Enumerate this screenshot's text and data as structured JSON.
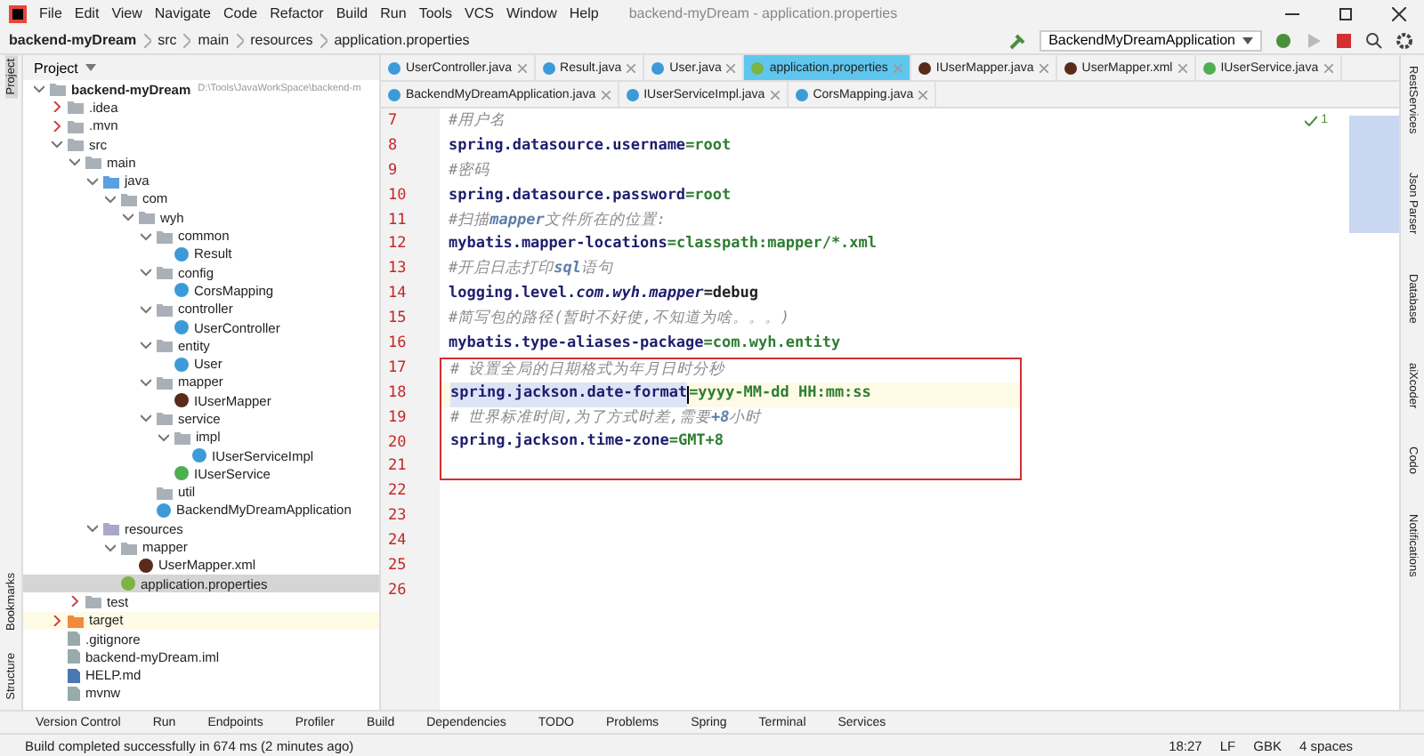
{
  "window": {
    "title": "backend-myDream - application.properties"
  },
  "menu": [
    "File",
    "Edit",
    "View",
    "Navigate",
    "Code",
    "Refactor",
    "Build",
    "Run",
    "Tools",
    "VCS",
    "Window",
    "Help"
  ],
  "breadcrumb": [
    "backend-myDream",
    "src",
    "main",
    "resources",
    "application.properties"
  ],
  "run_config": "BackendMyDreamApplication",
  "left_strip": [
    {
      "label": "Project",
      "selected": true
    },
    {
      "label": "Bookmarks",
      "selected": false
    },
    {
      "label": "Structure",
      "selected": false
    }
  ],
  "project": {
    "title": "Project",
    "tree": [
      {
        "label": "backend-myDream",
        "path": "D:\\Tools\\JavaWorkSpace\\backend-m",
        "kind": "module",
        "expanded": true,
        "selected": false,
        "children": [
          {
            "label": ".idea",
            "kind": "folder",
            "expanded": false,
            "selected": false
          },
          {
            "label": ".mvn",
            "kind": "folder",
            "expanded": false,
            "selected": false
          },
          {
            "label": "src",
            "kind": "folder",
            "expanded": true,
            "selected": false,
            "children": [
              {
                "label": "main",
                "kind": "folder",
                "expanded": true,
                "selected": false,
                "children": [
                  {
                    "label": "java",
                    "kind": "source",
                    "expanded": true,
                    "selected": false,
                    "children": [
                      {
                        "label": "com",
                        "kind": "package",
                        "expanded": true,
                        "selected": false,
                        "children": [
                          {
                            "label": "wyh",
                            "kind": "package",
                            "expanded": true,
                            "selected": false,
                            "children": [
                              {
                                "label": "common",
                                "kind": "package",
                                "expanded": true,
                                "selected": false,
                                "children": [
                                  {
                                    "label": "Result",
                                    "kind": "class",
                                    "selected": false
                                  }
                                ]
                              },
                              {
                                "label": "config",
                                "kind": "package",
                                "expanded": true,
                                "selected": false,
                                "children": [
                                  {
                                    "label": "CorsMapping",
                                    "kind": "class",
                                    "selected": false
                                  }
                                ]
                              },
                              {
                                "label": "controller",
                                "kind": "package",
                                "expanded": true,
                                "selected": false,
                                "children": [
                                  {
                                    "label": "UserController",
                                    "kind": "class",
                                    "selected": false
                                  }
                                ]
                              },
                              {
                                "label": "entity",
                                "kind": "package",
                                "expanded": true,
                                "selected": false,
                                "children": [
                                  {
                                    "label": "User",
                                    "kind": "class",
                                    "selected": false
                                  }
                                ]
                              },
                              {
                                "label": "mapper",
                                "kind": "package",
                                "expanded": true,
                                "selected": false,
                                "children": [
                                  {
                                    "label": "IUserMapper",
                                    "kind": "mapper",
                                    "selected": false
                                  }
                                ]
                              },
                              {
                                "label": "service",
                                "kind": "package",
                                "expanded": true,
                                "selected": false,
                                "children": [
                                  {
                                    "label": "impl",
                                    "kind": "package",
                                    "expanded": true,
                                    "selected": false,
                                    "children": [
                                      {
                                        "label": "IUserServiceImpl",
                                        "kind": "class",
                                        "selected": false
                                      }
                                    ]
                                  },
                                  {
                                    "label": "IUserService",
                                    "kind": "interface",
                                    "selected": false
                                  }
                                ]
                              },
                              {
                                "label": "util",
                                "kind": "package",
                                "selected": false
                              },
                              {
                                "label": "BackendMyDreamApplication",
                                "kind": "app",
                                "selected": false
                              }
                            ]
                          }
                        ]
                      }
                    ]
                  },
                  {
                    "label": "resources",
                    "kind": "resources",
                    "expanded": true,
                    "selected": false,
                    "children": [
                      {
                        "label": "mapper",
                        "kind": "folder",
                        "expanded": true,
                        "selected": false,
                        "children": [
                          {
                            "label": "UserMapper.xml",
                            "kind": "mapper",
                            "selected": false
                          }
                        ]
                      },
                      {
                        "label": "application.properties",
                        "kind": "properties",
                        "selected": true
                      }
                    ]
                  }
                ]
              },
              {
                "label": "test",
                "kind": "folder",
                "expanded": false,
                "selected": false
              }
            ]
          },
          {
            "label": "target",
            "kind": "excluded",
            "expanded": false,
            "selected": false
          },
          {
            "label": ".gitignore",
            "kind": "file",
            "selected": false
          },
          {
            "label": "backend-myDream.iml",
            "kind": "file",
            "selected": false
          },
          {
            "label": "HELP.md",
            "kind": "markdown",
            "selected": false
          },
          {
            "label": "mvnw",
            "kind": "file",
            "selected": false
          }
        ]
      }
    ]
  },
  "tabs": [
    [
      {
        "label": "UserController.java",
        "kind": "class",
        "selected": false
      },
      {
        "label": "Result.java",
        "kind": "class",
        "selected": false
      },
      {
        "label": "User.java",
        "kind": "class",
        "selected": false
      },
      {
        "label": "application.properties",
        "kind": "properties",
        "selected": true
      },
      {
        "label": "IUserMapper.java",
        "kind": "mapper",
        "selected": false
      },
      {
        "label": "UserMapper.xml",
        "kind": "mapper",
        "selected": false
      },
      {
        "label": "IUserService.java",
        "kind": "interface",
        "selected": false
      }
    ],
    [
      {
        "label": "BackendMyDreamApplication.java",
        "kind": "app",
        "selected": false
      },
      {
        "label": "IUserServiceImpl.java",
        "kind": "class",
        "selected": false
      },
      {
        "label": "CorsMapping.java",
        "kind": "class",
        "selected": false
      }
    ]
  ],
  "editor": {
    "inspection_count": "1",
    "lines": [
      {
        "number": "7",
        "kind": "comment",
        "text": "#用户名",
        "boxed": false,
        "current": false
      },
      {
        "number": "8",
        "kind": "property",
        "key": "spring.datasource.username",
        "value": "=root",
        "boxed": false,
        "current": false
      },
      {
        "number": "9",
        "kind": "comment",
        "text": "#密码",
        "boxed": false,
        "current": false
      },
      {
        "number": "10",
        "kind": "property",
        "key": "spring.datasource.password",
        "value": "=root",
        "boxed": false,
        "current": false
      },
      {
        "number": "11",
        "kind": "comment",
        "text": "#扫描**mapper**文件所在的位置:",
        "boxed": false,
        "current": false
      },
      {
        "number": "12",
        "kind": "property",
        "key": "mybatis.mapper-locations",
        "value": "=classpath:mapper/*.xml",
        "boxed": false,
        "current": false
      },
      {
        "number": "13",
        "kind": "comment",
        "text": "#开启日志打印**sql**语句",
        "boxed": false,
        "current": false
      },
      {
        "number": "14",
        "kind": "plain-property",
        "key": "logging.level.*com.wyh.mapper*",
        "value": "=debug",
        "boxed": false,
        "current": false
      },
      {
        "number": "15",
        "kind": "comment",
        "text": "#简写包的路径(暂时不好使,不知道为啥。。。)",
        "boxed": false,
        "current": false
      },
      {
        "number": "16",
        "kind": "property",
        "key": "mybatis.type-aliases-package",
        "value": "=com.wyh.entity",
        "boxed": false,
        "current": false
      },
      {
        "number": "17",
        "kind": "comment",
        "text": "# 设置全局的日期格式为年月日时分秒",
        "boxed": true,
        "current": false
      },
      {
        "number": "18",
        "kind": "property",
        "key": "spring.jackson.date-format",
        "value": "=yyyy-MM-dd HH:mm:ss",
        "boxed": true,
        "current": true
      },
      {
        "number": "19",
        "kind": "comment",
        "text": "# 世界标准时间,为了方式时差,需要**+8**小时",
        "boxed": true,
        "current": false
      },
      {
        "number": "20",
        "kind": "property",
        "key": "spring.jackson.time-zone",
        "value": "=GMT+8",
        "boxed": true,
        "current": false
      },
      {
        "number": "21",
        "kind": "empty",
        "boxed": true,
        "current": false
      },
      {
        "number": "22",
        "kind": "empty",
        "boxed": false,
        "current": false
      },
      {
        "number": "23",
        "kind": "empty",
        "boxed": false,
        "current": false
      },
      {
        "number": "24",
        "kind": "empty",
        "boxed": false,
        "current": false
      },
      {
        "number": "25",
        "kind": "empty",
        "boxed": false,
        "current": false
      },
      {
        "number": "26",
        "kind": "empty",
        "boxed": false,
        "current": false
      }
    ]
  },
  "right_strip": [
    "RestServices",
    "Json Parser",
    "Database",
    "aiXcoder",
    "Codo",
    "Notifications"
  ],
  "tool_windows": [
    "Version Control",
    "Run",
    "Endpoints",
    "Profiler",
    "Build",
    "Dependencies",
    "TODO",
    "Problems",
    "Spring",
    "Terminal",
    "Services"
  ],
  "status_bar": {
    "message": "Build completed successfully in 674 ms (2 minutes ago)",
    "items": [
      "18:27",
      "LF",
      "GBK",
      "4 spaces"
    ]
  }
}
